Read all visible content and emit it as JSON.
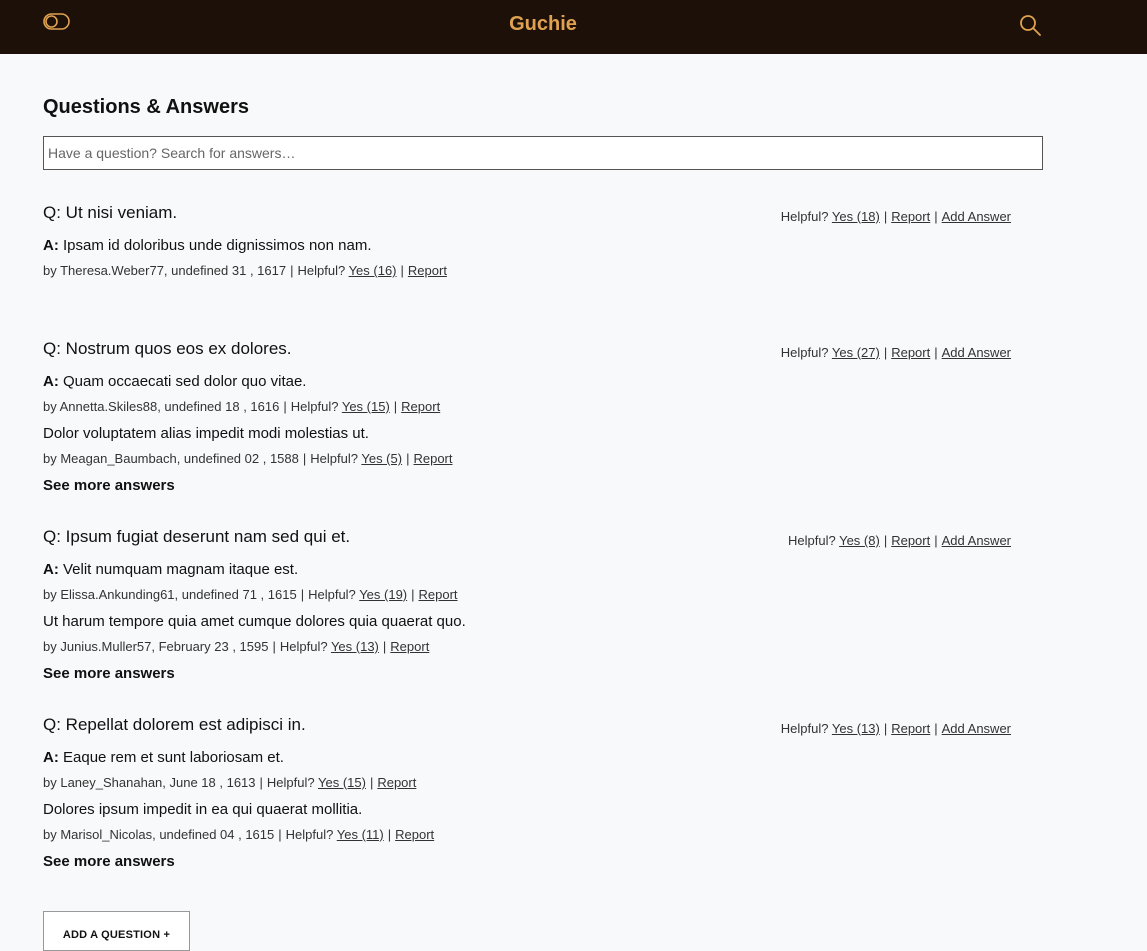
{
  "header": {
    "brand": "Guchie",
    "toggle_icon": "toggle-icon",
    "search_icon": "search-icon",
    "brand_color": "#e0a250",
    "bar_color": "#1c1008"
  },
  "section": {
    "title": "Questions & Answers",
    "search_placeholder": "Have a question? Search for answers…"
  },
  "questions": [
    {
      "text": "Q: Ut nisi veniam.",
      "helpful_label": "Helpful?",
      "yes_label": "Yes (18)",
      "report_label": "Report",
      "add_answer_label": "Add Answer",
      "answers": [
        {
          "prefix": "A:",
          "text": "Ipsam id doloribus unde dignissimos non nam.",
          "by": "by Theresa.Weber77, undefined 31 , 1617",
          "helpful_label": "Helpful?",
          "yes_label": "Yes (16)",
          "report_label": "Report"
        }
      ]
    },
    {
      "text": "Q: Nostrum quos eos ex dolores.",
      "helpful_label": "Helpful?",
      "yes_label": "Yes (27)",
      "report_label": "Report",
      "add_answer_label": "Add Answer",
      "answers": [
        {
          "prefix": "A:",
          "text": "Quam occaecati sed dolor quo vitae.",
          "by": "by Annetta.Skiles88, undefined 18 , 1616",
          "helpful_label": "Helpful?",
          "yes_label": "Yes (15)",
          "report_label": "Report"
        },
        {
          "prefix": "",
          "text": "Dolor voluptatem alias impedit modi molestias ut.",
          "by": "by Meagan_Baumbach, undefined 02 , 1588",
          "helpful_label": "Helpful?",
          "yes_label": "Yes (5)",
          "report_label": "Report"
        }
      ],
      "see_more": "See more answers"
    },
    {
      "text": "Q: Ipsum fugiat deserunt nam sed qui et.",
      "helpful_label": "Helpful?",
      "yes_label": "Yes (8)",
      "report_label": "Report",
      "add_answer_label": "Add Answer",
      "answers": [
        {
          "prefix": "A:",
          "text": "Velit numquam magnam itaque est.",
          "by": "by Elissa.Ankunding61, undefined 71 , 1615",
          "helpful_label": "Helpful?",
          "yes_label": "Yes (19)",
          "report_label": "Report"
        },
        {
          "prefix": "",
          "text": "Ut harum tempore quia amet cumque dolores quia quaerat quo.",
          "by": "by Junius.Muller57, February 23 , 1595",
          "helpful_label": "Helpful?",
          "yes_label": "Yes (13)",
          "report_label": "Report"
        }
      ],
      "see_more": "See more answers"
    },
    {
      "text": "Q: Repellat dolorem est adipisci in.",
      "helpful_label": "Helpful?",
      "yes_label": "Yes (13)",
      "report_label": "Report",
      "add_answer_label": "Add Answer",
      "answers": [
        {
          "prefix": "A:",
          "text": "Eaque rem et sunt laboriosam et.",
          "by": "by Laney_Shanahan, June 18 , 1613",
          "helpful_label": "Helpful?",
          "yes_label": "Yes (15)",
          "report_label": "Report"
        },
        {
          "prefix": "",
          "text": "Dolores ipsum impedit in ea qui quaerat mollitia.",
          "by": "by Marisol_Nicolas, undefined 04 , 1615",
          "helpful_label": "Helpful?",
          "yes_label": "Yes (11)",
          "report_label": "Report"
        }
      ],
      "see_more": "See more answers"
    }
  ],
  "add_question_label": "ADD A QUESTION +"
}
